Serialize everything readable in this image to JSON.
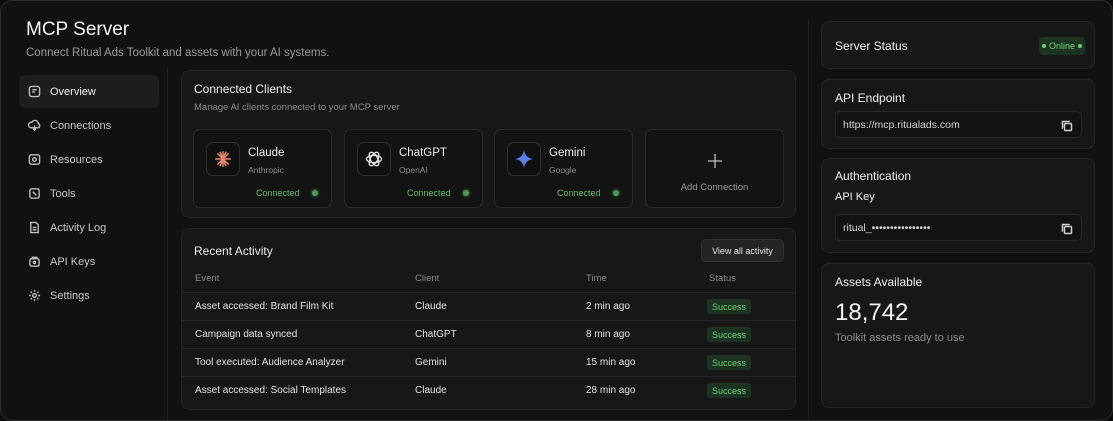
{
  "header": {
    "title": "MCP Server",
    "subtitle": "Connect Ritual Ads Toolkit and assets with your AI systems."
  },
  "sidebar": {
    "items": [
      {
        "label": "Overview",
        "icon": "overview-icon",
        "active": true
      },
      {
        "label": "Connections",
        "icon": "connections-icon"
      },
      {
        "label": "Resources",
        "icon": "resources-icon"
      },
      {
        "label": "Tools",
        "icon": "tools-icon"
      },
      {
        "label": "Activity Log",
        "icon": "activity-log-icon"
      },
      {
        "label": "API Keys",
        "icon": "key-icon"
      },
      {
        "label": "Settings",
        "icon": "settings-icon"
      }
    ]
  },
  "clients": {
    "title": "Connected Clients",
    "subtitle": "Manage AI clients connected to your MCP server",
    "cards": [
      {
        "name": "Claude",
        "vendor": "Anthropic",
        "status": "Connected",
        "icon": "claude-icon",
        "color": "#e8866a"
      },
      {
        "name": "ChatGPT",
        "vendor": "OpenAI",
        "status": "Connected",
        "icon": "chatgpt-icon",
        "color": "#e8e8e8"
      },
      {
        "name": "Gemini",
        "vendor": "Google",
        "status": "Connected",
        "icon": "gemini-icon",
        "color": "#5b7fe8"
      }
    ],
    "add_label": "Add Connection"
  },
  "activity": {
    "title": "Recent Activity",
    "view_all": "View all activity",
    "columns": [
      "Event",
      "Client",
      "Time",
      "Status"
    ],
    "rows": [
      {
        "event": "Asset accessed: Brand Film Kit",
        "client": "Claude",
        "time": "2 min ago",
        "status": "Success"
      },
      {
        "event": "Campaign data synced",
        "client": "ChatGPT",
        "time": "8 min ago",
        "status": "Success"
      },
      {
        "event": "Tool executed: Audience Analyzer",
        "client": "Gemini",
        "time": "15 min ago",
        "status": "Success"
      },
      {
        "event": "Asset accessed: Social Templates",
        "client": "Claude",
        "time": "28 min ago",
        "status": "Success"
      }
    ]
  },
  "server_status": {
    "title": "Server Status",
    "status": "Online"
  },
  "endpoint": {
    "title": "API Endpoint",
    "value": "https://mcp.ritualads.com"
  },
  "auth": {
    "title": "Authentication",
    "key_label": "API Key",
    "key_value": "ritual_••••••••••••••••"
  },
  "assets": {
    "title": "Assets Available",
    "count": "18,742",
    "subtitle": "Toolkit assets ready to use"
  },
  "colors": {
    "accent_green": "#6cd074",
    "background": "#111111",
    "panel": "#171717"
  }
}
